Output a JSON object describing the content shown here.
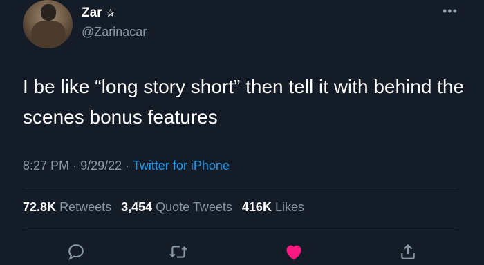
{
  "user": {
    "name": "Zar",
    "badge": "✰",
    "handle": "@Zarinacar"
  },
  "tweet": {
    "text": "I be like “long story short” then tell it with behind the scenes bonus features",
    "time": "8:27 PM",
    "date": "9/29/22",
    "source": "Twitter for iPhone"
  },
  "stats": {
    "retweets_count": "72.8K",
    "retweets_label": "Retweets",
    "quotes_count": "3,454",
    "quotes_label": "Quote Tweets",
    "likes_count": "416K",
    "likes_label": "Likes"
  },
  "actions": {
    "reply_icon": "reply-icon",
    "retweet_icon": "retweet-icon",
    "like_icon": "heart-icon",
    "share_icon": "share-icon"
  },
  "colors": {
    "background": "#141c27",
    "text": "#ffffff",
    "muted": "#8b98a5",
    "link": "#1d9bf0",
    "like": "#f91880"
  }
}
